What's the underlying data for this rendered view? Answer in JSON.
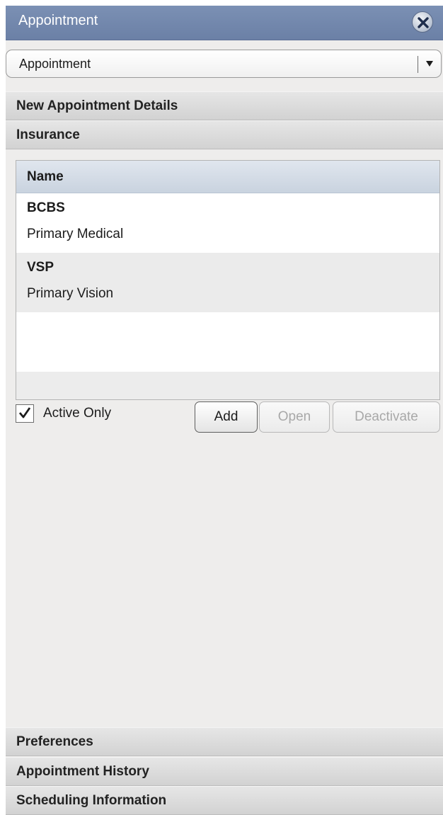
{
  "window": {
    "title": "Appointment"
  },
  "dropdown": {
    "selected": "Appointment"
  },
  "sections": {
    "new_appointment": "New Appointment Details",
    "insurance": "Insurance",
    "preferences": "Preferences",
    "history": "Appointment History",
    "scheduling": "Scheduling Information"
  },
  "insurance_list": {
    "column_header": "Name",
    "rows": [
      {
        "name": "BCBS",
        "type": "Primary Medical"
      },
      {
        "name": "VSP",
        "type": "Primary Vision"
      }
    ]
  },
  "filter": {
    "active_only_label": "Active Only",
    "active_only_checked": true
  },
  "buttons": {
    "add": "Add",
    "open": "Open",
    "deactivate": "Deactivate"
  },
  "colors": {
    "titlebar": "#7389ad",
    "panel_background": "#eeedec",
    "list_header": "#d2dbe6",
    "disabled_text": "#a8a8a8"
  },
  "icons": {
    "close": "close-icon",
    "dropdown": "chevron-down-icon",
    "check": "checkmark-icon"
  }
}
